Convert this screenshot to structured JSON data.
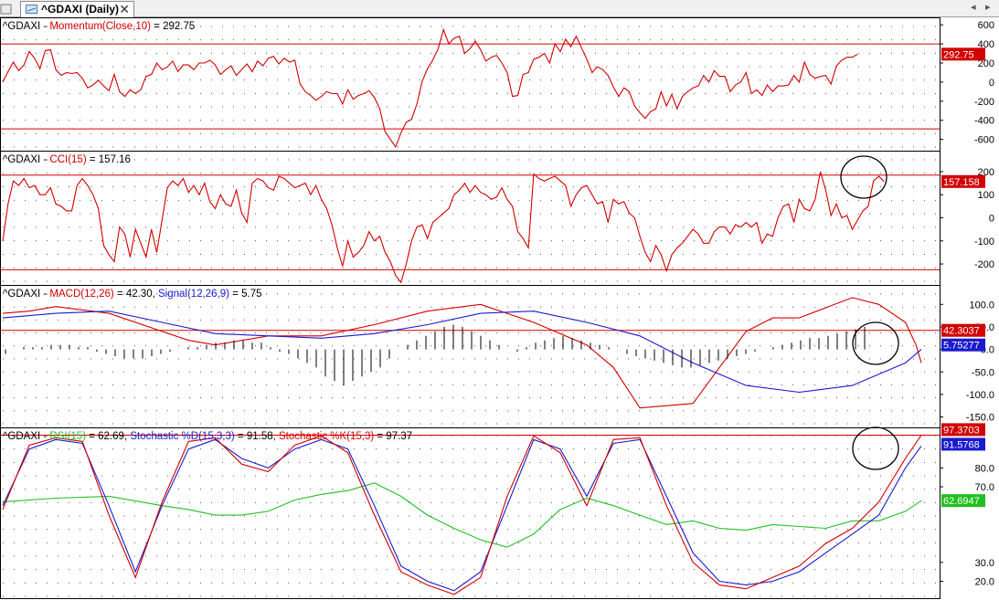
{
  "tab": {
    "title": "^GDAXI (Daily)",
    "close": "✕",
    "nav_left": "◂",
    "nav_right": "▸"
  },
  "colors": {
    "red": "#d20000",
    "blue": "#1a1ad0",
    "green": "#20c020",
    "black": "#000000"
  },
  "chart_data": [
    {
      "type": "line",
      "symbol": "^GDAXI",
      "title_parts": [
        {
          "text": "^GDAXI - ",
          "color": "#000000"
        },
        {
          "text": "Momentum(Close,10)",
          "color": "#d20000"
        },
        {
          "text": " = 292.75",
          "color": "#000000"
        }
      ],
      "ylim": [
        -680,
        640
      ],
      "yticks": [
        "600",
        "400",
        "200",
        "0",
        "-200",
        "-400",
        "-600"
      ],
      "ytick_values": [
        600,
        400,
        200,
        0,
        -200,
        -400,
        -600
      ],
      "reference_lines": [
        400,
        -490
      ],
      "value_label": "292.75",
      "value_label_color": "#d20000",
      "series": [
        {
          "color": "#d20000",
          "values": [
            0,
            110,
            210,
            120,
            180,
            320,
            250,
            140,
            330,
            340,
            130,
            70,
            100,
            90,
            100,
            40,
            -60,
            -30,
            20,
            -40,
            -90,
            80,
            -100,
            -150,
            -80,
            -120,
            -80,
            60,
            80,
            200,
            130,
            160,
            220,
            110,
            180,
            180,
            130,
            200,
            200,
            230,
            180,
            80,
            130,
            170,
            70,
            130,
            190,
            110,
            220,
            170,
            250,
            270,
            190,
            250,
            210,
            230,
            -20,
            -100,
            -140,
            -190,
            -150,
            -100,
            -120,
            -120,
            -230,
            -80,
            -180,
            -140,
            -120,
            -90,
            -160,
            -280,
            -520,
            -600,
            -680,
            -530,
            -420,
            -390,
            -230,
            10,
            140,
            230,
            350,
            550,
            400,
            460,
            480,
            300,
            350,
            430,
            340,
            220,
            260,
            280,
            200,
            100,
            -150,
            -140,
            80,
            100,
            240,
            260,
            300,
            200,
            400,
            320,
            450,
            370,
            480,
            360,
            240,
            100,
            160,
            130,
            70,
            -50,
            -150,
            -60,
            -100,
            -250,
            -320,
            -380,
            -310,
            -280,
            -100,
            -250,
            -130,
            -280,
            -150,
            -100,
            -60,
            -40,
            70,
            0,
            120,
            60,
            60,
            -100,
            -30,
            0,
            100,
            -120,
            -80,
            -140,
            -30,
            -100,
            -40,
            -40,
            -30,
            70,
            0,
            210,
            80,
            40,
            60,
            70,
            -20,
            170,
            230,
            260,
            260,
            292.75
          ]
        }
      ]
    },
    {
      "type": "line",
      "symbol": "^GDAXI",
      "title_parts": [
        {
          "text": "^GDAXI - ",
          "color": "#000000"
        },
        {
          "text": "CCI(15)",
          "color": "#d20000"
        },
        {
          "text": " = 157.16",
          "color": "#000000"
        }
      ],
      "ylim": [
        -275,
        275
      ],
      "yticks": [
        "200",
        "100",
        "0",
        "-100",
        "-200"
      ],
      "ytick_values": [
        200,
        100,
        0,
        -100,
        -200
      ],
      "reference_lines": [
        185,
        -225
      ],
      "value_label": "157.158",
      "value_label_color": "#d20000",
      "annotation": "circle",
      "series": [
        {
          "color": "#d20000",
          "values": [
            -100,
            60,
            160,
            140,
            170,
            130,
            140,
            100,
            100,
            130,
            60,
            50,
            30,
            30,
            140,
            170,
            140,
            100,
            40,
            -120,
            -160,
            -190,
            -40,
            -70,
            -170,
            -50,
            -110,
            -170,
            -50,
            -150,
            -10,
            130,
            160,
            140,
            170,
            110,
            140,
            100,
            150,
            70,
            40,
            100,
            60,
            50,
            120,
            20,
            -20,
            150,
            170,
            160,
            130,
            120,
            180,
            170,
            150,
            130,
            140,
            150,
            100,
            140,
            80,
            40,
            -30,
            -130,
            -210,
            -100,
            -170,
            -150,
            -120,
            -60,
            -100,
            -80,
            -150,
            -190,
            -250,
            -280,
            -200,
            -100,
            -40,
            -30,
            -90,
            -20,
            0,
            20,
            40,
            100,
            120,
            150,
            110,
            140,
            110,
            100,
            80,
            90,
            130,
            80,
            50,
            -60,
            -90,
            -130,
            190,
            170,
            160,
            170,
            180,
            160,
            140,
            50,
            100,
            130,
            140,
            100,
            60,
            70,
            -20,
            80,
            60,
            70,
            20,
            0,
            -80,
            -150,
            -190,
            -120,
            -160,
            -230,
            -160,
            -130,
            -110,
            -80,
            -50,
            -70,
            -110,
            -110,
            -60,
            -40,
            -40,
            -70,
            -30,
            -40,
            -20,
            -40,
            -20,
            -110,
            -70,
            -80,
            0,
            50,
            60,
            -20,
            80,
            40,
            30,
            80,
            200,
            120,
            10,
            60,
            0,
            10,
            -50,
            -10,
            30,
            50,
            160,
            180,
            157.16
          ]
        }
      ]
    },
    {
      "type": "line",
      "symbol": "^GDAXI",
      "title_parts": [
        {
          "text": "^GDAXI - ",
          "color": "#000000"
        },
        {
          "text": "MACD(12,26)",
          "color": "#d20000"
        },
        {
          "text": " = 42.30, ",
          "color": "#000000"
        },
        {
          "text": "Signal(12,26,9)",
          "color": "#1a1ad0"
        },
        {
          "text": " = 5.75",
          "color": "#000000"
        }
      ],
      "ylim": [
        -165,
        135
      ],
      "yticks": [
        "100.0",
        "50.0",
        "0.0",
        "-50.0",
        "-100.0",
        "-150.0"
      ],
      "ytick_values": [
        100,
        50,
        0,
        -50,
        -100,
        -150
      ],
      "reference_lines": [
        42.3
      ],
      "value_labels": [
        {
          "text": "42.3037",
          "color": "#d20000"
        },
        {
          "text": "5.75277",
          "color": "#1a1ad0"
        }
      ],
      "annotation": "circle",
      "series": [
        {
          "name": "MACD",
          "color": "#d20000",
          "x": [
            0,
            5,
            10,
            20,
            30,
            35,
            40,
            50,
            60,
            70,
            80,
            90,
            100,
            110,
            115,
            120,
            130,
            135,
            140,
            145,
            150,
            160,
            165,
            170,
            172,
            173
          ],
          "values": [
            80,
            85,
            95,
            80,
            40,
            20,
            10,
            30,
            30,
            55,
            85,
            100,
            60,
            10,
            -40,
            -130,
            -120,
            -40,
            40,
            70,
            70,
            115,
            100,
            60,
            10,
            -30
          ]
        },
        {
          "name": "Signal",
          "color": "#1a1ad0",
          "x": [
            0,
            10,
            20,
            30,
            40,
            50,
            60,
            70,
            80,
            90,
            100,
            110,
            120,
            130,
            140,
            150,
            160,
            170,
            173
          ],
          "values": [
            70,
            80,
            85,
            60,
            35,
            30,
            25,
            35,
            55,
            80,
            85,
            60,
            30,
            -30,
            -80,
            -95,
            -80,
            -30,
            0
          ]
        },
        {
          "name": "Histogram",
          "color": "#000000",
          "values": [
            -10,
            0,
            5,
            5,
            5,
            10,
            10,
            10,
            5,
            5,
            -5,
            -10,
            -15,
            -20,
            -20,
            -20,
            -15,
            -10,
            -5,
            0,
            5,
            5,
            10,
            15,
            15,
            20,
            20,
            15,
            15,
            5,
            -5,
            -10,
            -20,
            -30,
            -40,
            -60,
            -70,
            -80,
            -70,
            -60,
            -50,
            -40,
            -20,
            0,
            10,
            20,
            30,
            40,
            50,
            55,
            50,
            40,
            30,
            20,
            10,
            0,
            -5,
            5,
            15,
            20,
            25,
            30,
            25,
            20,
            15,
            10,
            5,
            0,
            -10,
            -15,
            -20,
            -25,
            -30,
            -35,
            -40,
            -40,
            -35,
            -30,
            -25,
            -20,
            -15,
            -10,
            -5,
            0,
            5,
            10,
            15,
            20,
            25,
            25,
            30,
            35,
            40,
            45,
            50
          ]
        }
      ]
    },
    {
      "type": "line",
      "symbol": "^GDAXI",
      "title_parts": [
        {
          "text": "^GDAXI - ",
          "color": "#000000"
        },
        {
          "text": "RSI(15)",
          "color": "#20c020"
        },
        {
          "text": " = 62.69, ",
          "color": "#000000"
        },
        {
          "text": "Stochastic %D(15,3,3)",
          "color": "#1a1ad0"
        },
        {
          "text": " = 91.58, ",
          "color": "#000000"
        },
        {
          "text": "Stochastic %K(15,3)",
          "color": "#d20000"
        },
        {
          "text": " = 97.37",
          "color": "#000000"
        }
      ],
      "ylim": [
        12,
        100
      ],
      "yticks": [
        "80.0",
        "70.0",
        "30.0",
        "20.0"
      ],
      "ytick_values": [
        80,
        70,
        30,
        20
      ],
      "reference_lines": [
        97.37
      ],
      "value_labels": [
        {
          "text": "97.3703",
          "color": "#d20000"
        },
        {
          "text": "91.5768",
          "color": "#1a1ad0"
        },
        {
          "text": "62.6947",
          "color": "#20c020"
        }
      ],
      "annotation": "circle",
      "series": [
        {
          "name": "RSI",
          "color": "#20c020",
          "x": [
            0,
            10,
            20,
            30,
            35,
            40,
            45,
            50,
            55,
            60,
            65,
            70,
            75,
            80,
            85,
            90,
            95,
            100,
            105,
            110,
            115,
            120,
            125,
            130,
            135,
            140,
            145,
            150,
            155,
            160,
            165,
            170,
            173
          ],
          "values": [
            62,
            64,
            65,
            60,
            58,
            55,
            55,
            57,
            63,
            66,
            68,
            72,
            65,
            55,
            48,
            42,
            38,
            45,
            58,
            64,
            60,
            55,
            50,
            52,
            48,
            47,
            50,
            49,
            48,
            52,
            52,
            57,
            62.69
          ]
        },
        {
          "name": "Stochastic %D",
          "color": "#1a1ad0",
          "x": [
            0,
            5,
            10,
            15,
            20,
            25,
            30,
            35,
            40,
            45,
            50,
            55,
            60,
            65,
            70,
            75,
            80,
            85,
            90,
            95,
            100,
            105,
            110,
            115,
            120,
            125,
            130,
            135,
            140,
            145,
            150,
            155,
            160,
            165,
            170,
            173
          ],
          "values": [
            60,
            90,
            95,
            93,
            60,
            25,
            60,
            90,
            95,
            85,
            80,
            90,
            95,
            90,
            60,
            28,
            20,
            15,
            25,
            60,
            95,
            90,
            65,
            93,
            95,
            65,
            35,
            20,
            18,
            20,
            25,
            35,
            45,
            55,
            80,
            91.58
          ]
        },
        {
          "name": "Stochastic %K",
          "color": "#d20000",
          "x": [
            0,
            5,
            10,
            15,
            20,
            25,
            30,
            35,
            40,
            45,
            50,
            55,
            60,
            65,
            70,
            75,
            80,
            85,
            90,
            95,
            100,
            105,
            110,
            115,
            120,
            125,
            130,
            135,
            140,
            145,
            150,
            155,
            160,
            165,
            170,
            173
          ],
          "values": [
            58,
            92,
            96,
            94,
            55,
            22,
            62,
            94,
            96,
            82,
            78,
            92,
            97,
            88,
            55,
            25,
            18,
            13,
            22,
            65,
            97,
            88,
            60,
            95,
            96,
            60,
            30,
            18,
            16,
            22,
            28,
            40,
            48,
            62,
            85,
            97.37
          ]
        }
      ]
    }
  ]
}
